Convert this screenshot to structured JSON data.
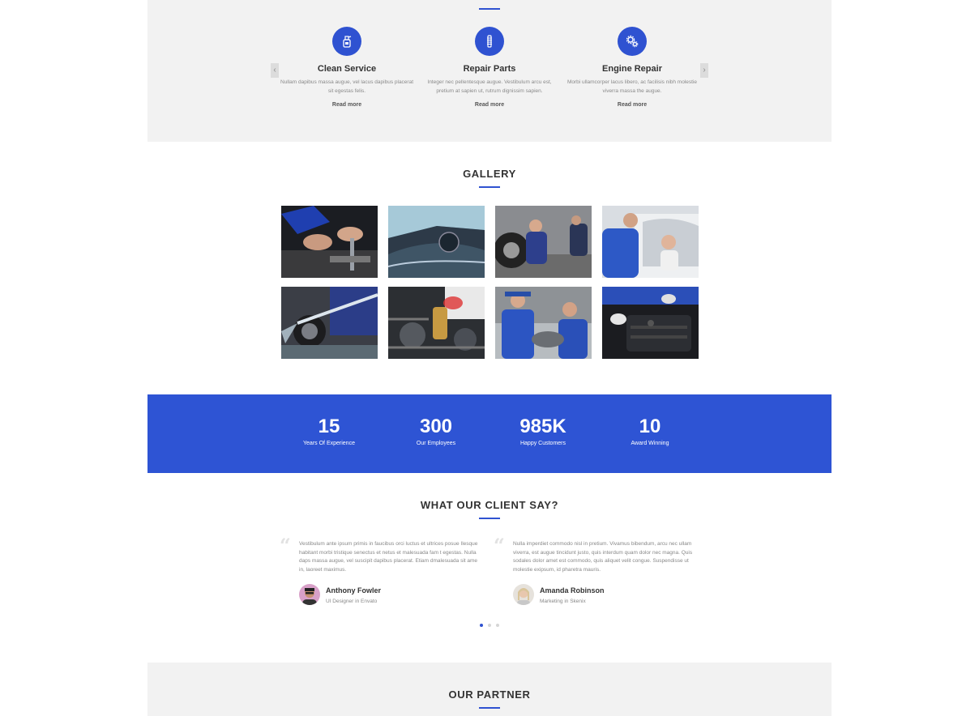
{
  "services": {
    "items": [
      {
        "title": "Clean Service",
        "icon": "spray-bottle-icon",
        "description": "Nullam dapibus massa augue, vel lacus dapibus placerat sit egestas felis.",
        "link": "Read more"
      },
      {
        "title": "Repair Parts",
        "icon": "spring-part-icon",
        "description": "Integer nec pellentesque augue. Vestibulum arcu est, pretium at sapien ut, rutrum dignissim sapien.",
        "link": "Read more"
      },
      {
        "title": "Engine Repair",
        "icon": "gears-icon",
        "description": "Morbi ullamcorper lacus libero, ac facilisis nibh molestie viverra massa the augue.",
        "link": "Read more"
      }
    ],
    "prev_label": "‹",
    "next_label": "›"
  },
  "gallery": {
    "title": "GALLERY"
  },
  "counters": [
    {
      "value": "15",
      "label": "Years Of Experience"
    },
    {
      "value": "300",
      "label": "Our Employees"
    },
    {
      "value": "985K",
      "label": "Happy Customers"
    },
    {
      "value": "10",
      "label": "Award Winning"
    }
  ],
  "testimonials": {
    "title": "WHAT OUR CLIENT SAY?",
    "quote_glyph": "“",
    "items": [
      {
        "text": "Vestibulum ante ipsum primis in faucibus orci luctus et ultrices posue Ilesque habitant morbi tristique senectus et netus et malesuada fam t egestas. Nulla daps massa augue, vel suscipit dapibus placerat. Etiam dmalesuada sit ame in, laoreet maximus.",
        "name": "Anthony Fowler",
        "role": "UI Designer in Envato"
      },
      {
        "text": "Nulla imperdiet commodo nisl in pretium. Vivamus bibendum, arcu nec ullam viverra, est augue tincidunt justo, quis interdum quam dolor nec magna. Quis sodales dolor amet est commodo, quis aliquet velit congue. Suspendisse ut molestie exipsum, id pharetra mauris.",
        "name": "Amanda Robinson",
        "role": "Marketing in Skenix"
      }
    ]
  },
  "partner": {
    "title": "OUR PARTNER"
  },
  "colors": {
    "accent": "#2f52d1",
    "counter_bg": "#2e54d4",
    "section_gray": "#f2f2f2"
  }
}
